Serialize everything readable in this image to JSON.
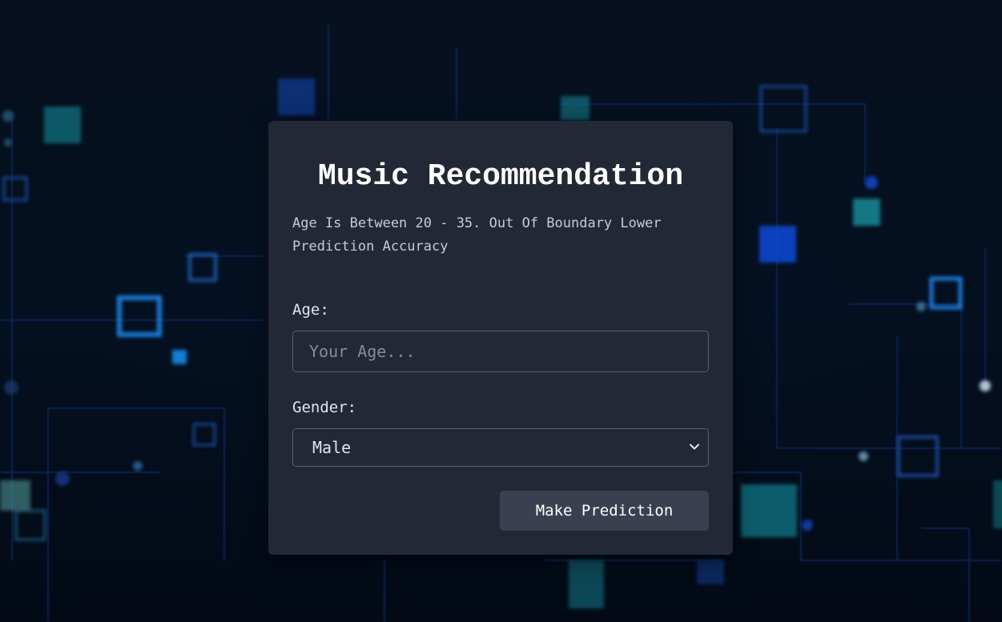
{
  "app": {
    "title": "Music Recommendation",
    "note": "Age Is Between 20 - 35. Out Of Boundary Lower Prediction Accuracy"
  },
  "form": {
    "age_label": "Age:",
    "age_placeholder": "Your Age...",
    "age_value": "",
    "gender_label": "Gender:",
    "gender_selected": "Male",
    "submit_label": "Make Prediction"
  },
  "colors": {
    "background": "#050d1a",
    "card": "#222836",
    "button": "#3a4050",
    "text": "#ffffff"
  },
  "icons": {
    "select_caret": "chevron-down-icon"
  }
}
